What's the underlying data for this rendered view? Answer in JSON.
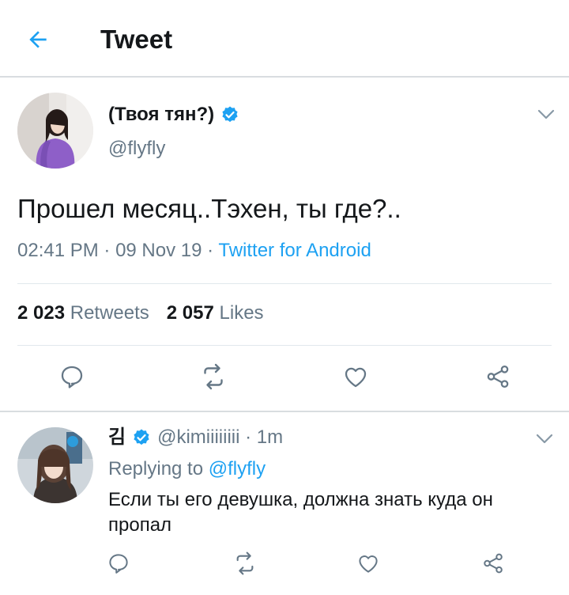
{
  "header": {
    "title": "Tweet",
    "back_icon": "arrow-left-icon"
  },
  "colors": {
    "accent": "#1da1f2",
    "text": "#14171a",
    "muted": "#657786",
    "divider": "#e1e8ed"
  },
  "tweet": {
    "author_name": "(Твоя тян?)",
    "author_handle": "@flyfly",
    "verified": true,
    "text": "Прошел месяц..Тэхен, ты где?..",
    "time": "02:41 PM",
    "date": "09 Nov 19",
    "separator": " · ",
    "source": "Twitter for Android",
    "retweets_count": "2 023",
    "retweets_label": "Retweets",
    "likes_count": "2 057",
    "likes_label": "Likes"
  },
  "reply": {
    "author_name": "김",
    "verified": true,
    "author_handle": "@kimiiiiiiii",
    "time_ago": "1m",
    "separator": " · ",
    "replying_prefix": "Replying to",
    "replying_to": "@flyfly",
    "text": "Если ты его девушка, должна знать куда он пропал"
  },
  "actions": [
    "reply-icon",
    "retweet-icon",
    "like-icon",
    "share-icon"
  ]
}
